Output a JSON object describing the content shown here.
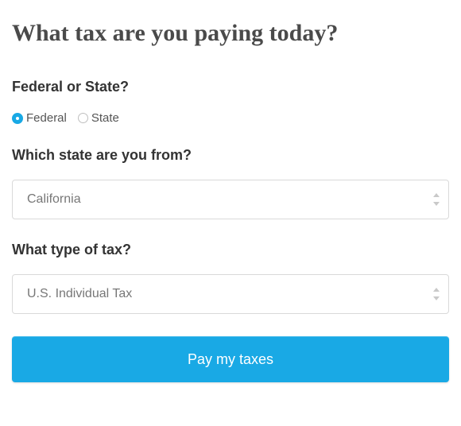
{
  "title": "What tax are you paying today?",
  "questions": {
    "jurisdiction": "Federal or State?",
    "state": "Which state are you from?",
    "taxType": "What type of tax?"
  },
  "radio": {
    "federal": {
      "label": "Federal",
      "selected": true
    },
    "state": {
      "label": "State",
      "selected": false
    }
  },
  "selects": {
    "state": {
      "value": "California"
    },
    "taxType": {
      "value": "U.S. Individual Tax"
    }
  },
  "submit": {
    "label": "Pay my taxes"
  },
  "colors": {
    "accent": "#19a9e5"
  }
}
